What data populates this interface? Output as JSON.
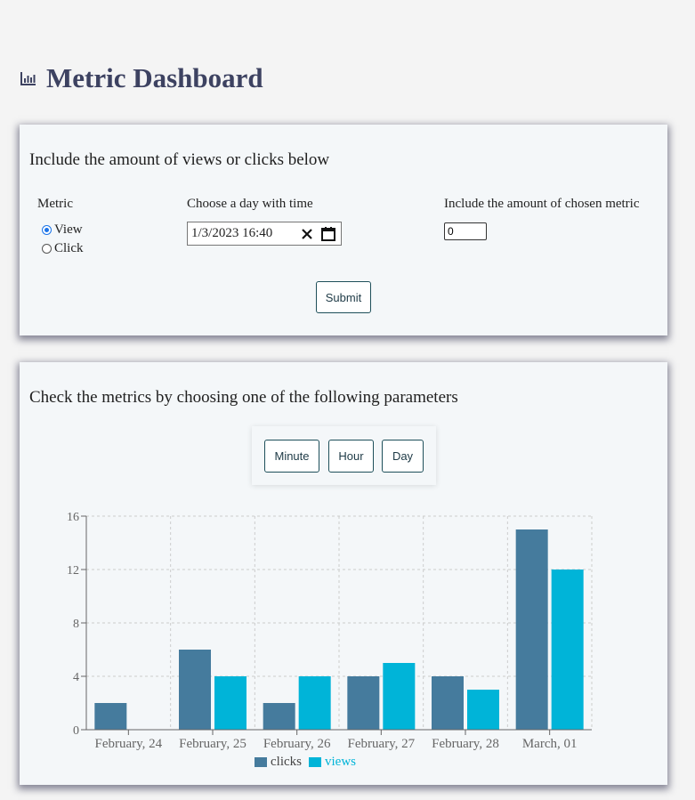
{
  "header": {
    "title": "Metric Dashboard",
    "icon": "bar-chart-icon"
  },
  "form": {
    "heading": "Include the amount of views or clicks below",
    "metric_label": "Metric",
    "options": [
      {
        "label": "View",
        "checked": true
      },
      {
        "label": "Click",
        "checked": false
      }
    ],
    "datetime_label": "Choose a day with time",
    "datetime_value": "1/3/2023 16:40",
    "amount_label": "Include the amount of chosen metric",
    "amount_value": "0",
    "submit_label": "Submit"
  },
  "metrics": {
    "heading": "Check the metrics by choosing one of the following parameters",
    "buttons": [
      "Minute",
      "Hour",
      "Day"
    ]
  },
  "chart_data": {
    "type": "bar",
    "categories": [
      "February, 24",
      "February, 25",
      "February, 26",
      "February, 27",
      "February, 28",
      "March, 01"
    ],
    "series": [
      {
        "name": "clicks",
        "values": [
          2,
          6,
          2,
          4,
          4,
          15
        ],
        "color": "#457b9d"
      },
      {
        "name": "views",
        "values": [
          0,
          4,
          4,
          5,
          3,
          12
        ],
        "color": "#00b4d8"
      }
    ],
    "ylim": [
      0,
      16
    ],
    "yticks": [
      0,
      4,
      8,
      12,
      16
    ],
    "grid": true,
    "legend": "bottom"
  }
}
